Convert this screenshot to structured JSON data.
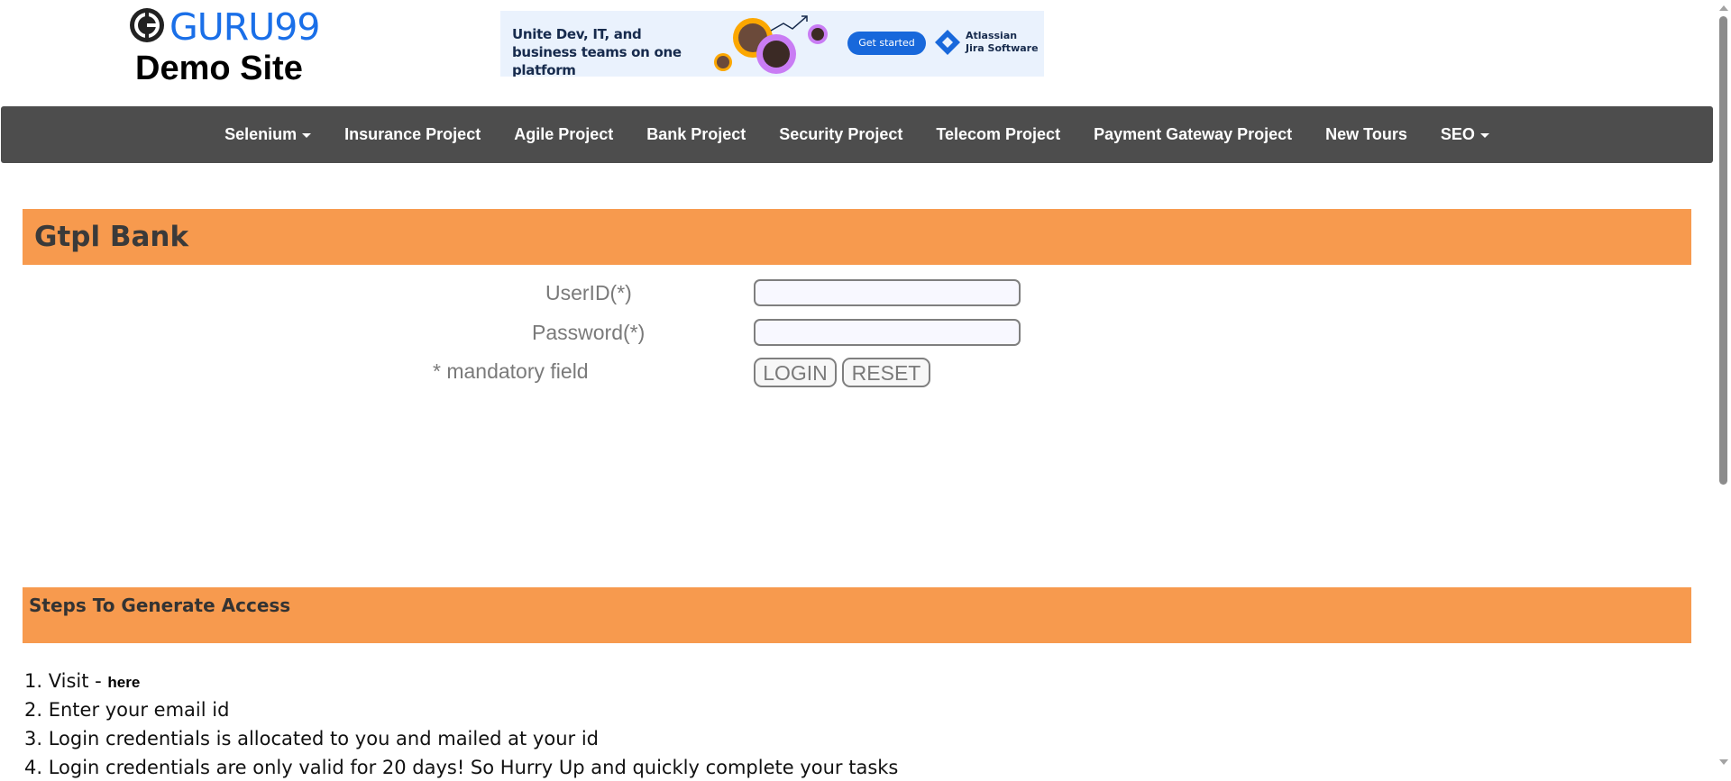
{
  "header": {
    "brand_name": "GURU99",
    "brand_subtitle": "Demo Site"
  },
  "ad": {
    "text": "Unite Dev, IT, and business teams on one platform",
    "button": "Get started",
    "brand_line1": "Atlassian",
    "brand_line2": "Jira Software",
    "accent_color": "#1868db"
  },
  "nav": {
    "items": [
      {
        "label": "Selenium",
        "dropdown": true
      },
      {
        "label": "Insurance Project",
        "dropdown": false
      },
      {
        "label": "Agile Project",
        "dropdown": false
      },
      {
        "label": "Bank Project",
        "dropdown": false
      },
      {
        "label": "Security Project",
        "dropdown": false
      },
      {
        "label": "Telecom Project",
        "dropdown": false
      },
      {
        "label": "Payment Gateway Project",
        "dropdown": false
      },
      {
        "label": "New Tours",
        "dropdown": false
      },
      {
        "label": "SEO",
        "dropdown": true
      }
    ],
    "background": "#4d4d4d"
  },
  "bank": {
    "title": "Gtpl Bank",
    "banner_color": "#f79a4e"
  },
  "form": {
    "userid_label": "UserID(*)",
    "userid_value": "",
    "password_label": "Password(*)",
    "password_value": "",
    "mandatory_note": "* mandatory field",
    "login_label": "LOGIN",
    "reset_label": "RESET"
  },
  "steps": {
    "title": "Steps To Generate Access",
    "items": [
      {
        "text": "1. Visit - ",
        "link": "here"
      },
      {
        "text": "2. Enter your email id"
      },
      {
        "text": "3. Login credentials is allocated to you and mailed at your id"
      },
      {
        "text": "4. Login credentials are only valid for 20 days! So Hurry Up and quickly complete your tasks"
      }
    ]
  }
}
